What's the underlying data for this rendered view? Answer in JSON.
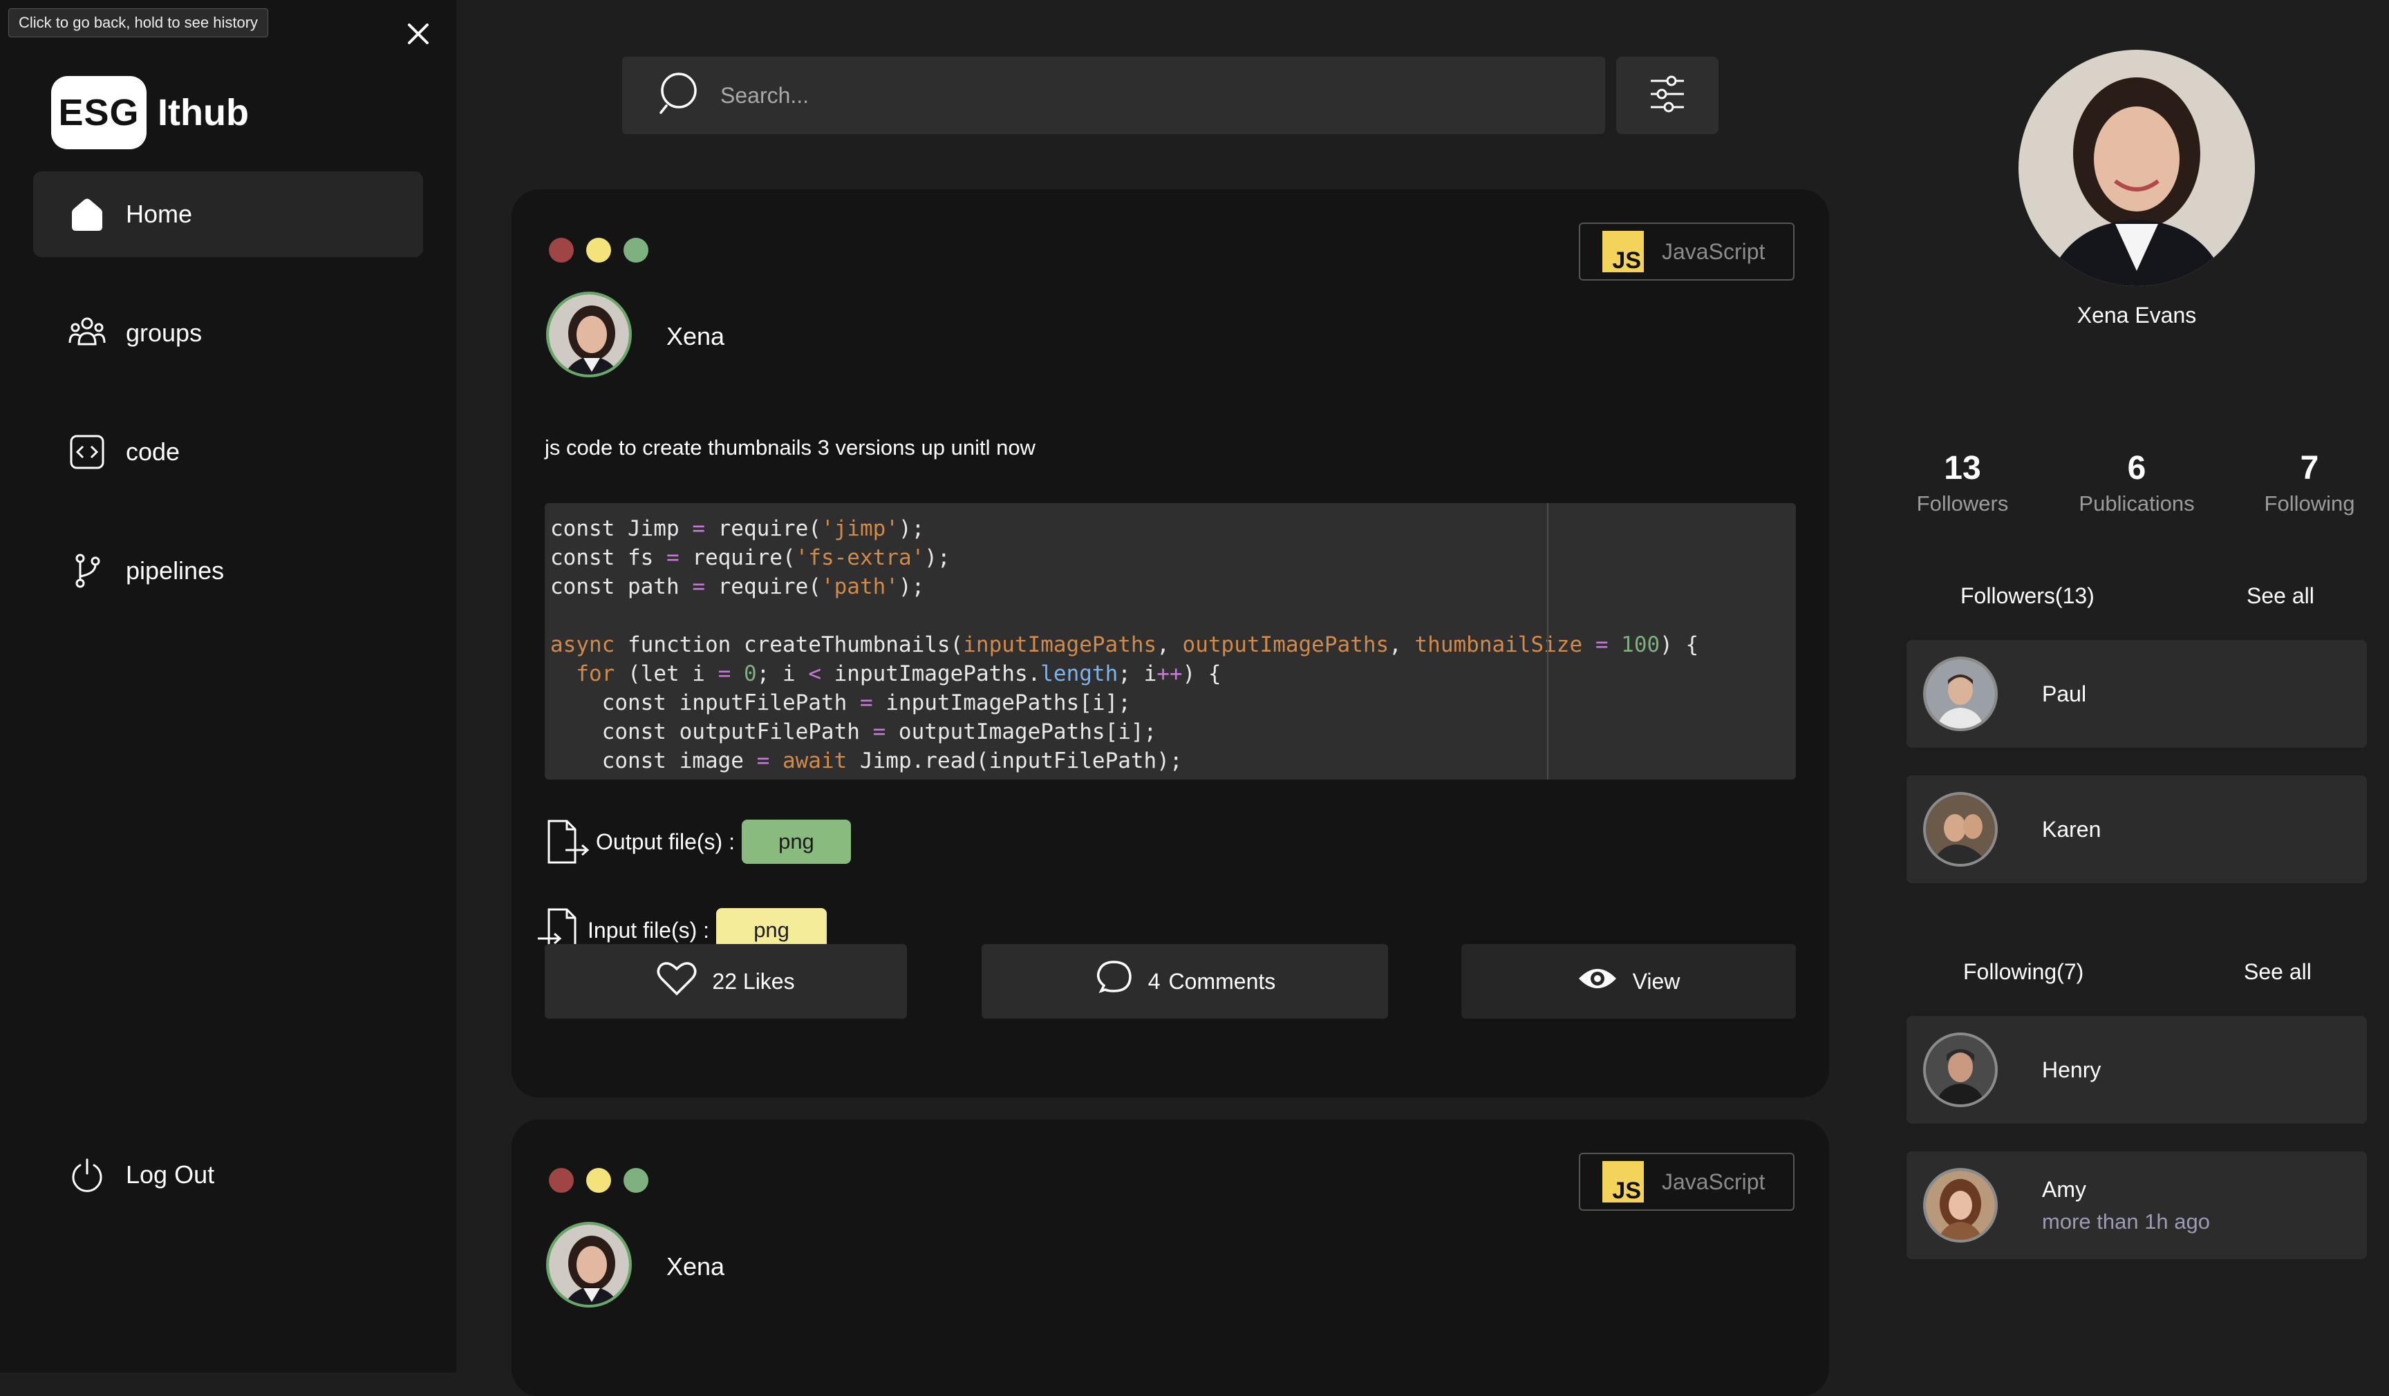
{
  "tooltip": "Click to go back, hold to see history",
  "logo": {
    "mark": "ESG",
    "text": "Ithub"
  },
  "nav": {
    "home": "Home",
    "groups": "groups",
    "code": "code",
    "pipelines": "pipelines",
    "logout": "Log Out"
  },
  "search": {
    "placeholder": "Search..."
  },
  "posts": [
    {
      "lang_mark": "JS",
      "language": "JavaScript",
      "author": "Xena",
      "description": "js code to create thumbnails 3 versions up unitl now",
      "output_label": "Output file(s) :",
      "output_type": "png",
      "input_label": "Input file(s) :",
      "input_type": "png",
      "likes": "22 Likes",
      "comments_count": "4",
      "comments_label": "Comments",
      "view": "View"
    },
    {
      "lang_mark": "JS",
      "language": "JavaScript",
      "author": "Xena"
    }
  ],
  "profile": {
    "name": "Xena Evans",
    "stats": [
      {
        "value": "13",
        "label": "Followers"
      },
      {
        "value": "6",
        "label": "Publications"
      },
      {
        "value": "7",
        "label": "Following"
      }
    ],
    "followers_title": "Followers(13)",
    "following_title": "Following(7)",
    "see_all": "See all",
    "followers": [
      {
        "name": "Paul"
      },
      {
        "name": "Karen"
      }
    ],
    "following": [
      {
        "name": "Henry"
      },
      {
        "name": "Amy",
        "status": "more than 1h ago"
      }
    ]
  },
  "colors": {
    "dot_red": "#a04545",
    "dot_yellow": "#f4e27a",
    "dot_green": "#7fb07f",
    "tag_output": "#89ba7e",
    "tag_input": "#f5ec9a",
    "js_badge": "#f3d35a"
  }
}
